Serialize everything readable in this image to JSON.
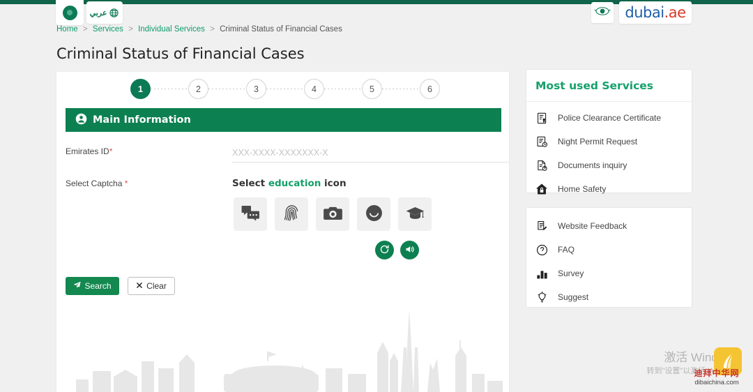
{
  "header": {
    "logo_icon": "dubai-police-logo-icon",
    "language_label": "عربي",
    "language_icon": "globe-icon",
    "seal_icon": "government-seal-icon",
    "brand_primary": "dubai",
    "brand_suffix": ".ae"
  },
  "breadcrumb": {
    "items": [
      "Home",
      "Services",
      "Individual Services",
      "Criminal Status of Financial Cases"
    ],
    "separator": ">"
  },
  "page": {
    "title": "Criminal Status of Financial Cases"
  },
  "stepper": {
    "steps": [
      "1",
      "2",
      "3",
      "4",
      "5",
      "6"
    ],
    "active_index": 0
  },
  "form": {
    "section_title": "Main Information",
    "section_icon": "user-circle-icon",
    "emirates_id": {
      "label": "Emirates ID",
      "required_mark": "*",
      "placeholder": "XXX-XXXX-XXXXXXX-X",
      "value": "",
      "person_icon": "person-icon",
      "keyboard_icon": "keyboard-icon"
    },
    "captcha": {
      "label": "Select Captcha",
      "required_mark": "*",
      "prompt_prefix": "Select ",
      "prompt_keyword": "education",
      "prompt_suffix": " icon",
      "options": [
        {
          "name": "chat-bubbles-icon"
        },
        {
          "name": "fingerprint-icon"
        },
        {
          "name": "camera-icon"
        },
        {
          "name": "smiley-face-icon"
        },
        {
          "name": "graduation-cap-icon"
        }
      ],
      "refresh_icon": "refresh-icon",
      "audio_icon": "speaker-icon"
    },
    "buttons": {
      "search": "Search",
      "search_icon": "paper-plane-icon",
      "clear": "Clear",
      "clear_icon": "times-icon"
    },
    "background_art": "dubai-skyline-illustration"
  },
  "most_used_services": {
    "title": "Most used Services",
    "items": [
      {
        "label": "Police Clearance Certificate",
        "icon": "certificate-icon"
      },
      {
        "label": "Night Permit Request",
        "icon": "permit-clock-icon"
      },
      {
        "label": "Documents inquiry",
        "icon": "document-question-icon"
      },
      {
        "label": "Home Safety",
        "icon": "home-lock-icon"
      }
    ]
  },
  "quick_links": {
    "items": [
      {
        "label": "Website Feedback",
        "icon": "feedback-pencil-icon"
      },
      {
        "label": "FAQ",
        "icon": "question-circle-icon"
      },
      {
        "label": "Survey",
        "icon": "bar-chart-icon"
      },
      {
        "label": "Suggest",
        "icon": "lightbulb-icon"
      }
    ]
  },
  "watermarks": {
    "windows_line1": "激活 Windows",
    "windows_line2": "转到\"设置\"以激活 Windows",
    "site_chinese": "迪拜中华网",
    "site_url": "dibaichina.com"
  },
  "colors": {
    "brand_green": "#0c8050",
    "accent_green": "#16a06b",
    "topbar_green": "#10644a",
    "required_red": "#d9534f",
    "logo_blue": "#1f5fa9",
    "logo_red": "#d8392b"
  }
}
